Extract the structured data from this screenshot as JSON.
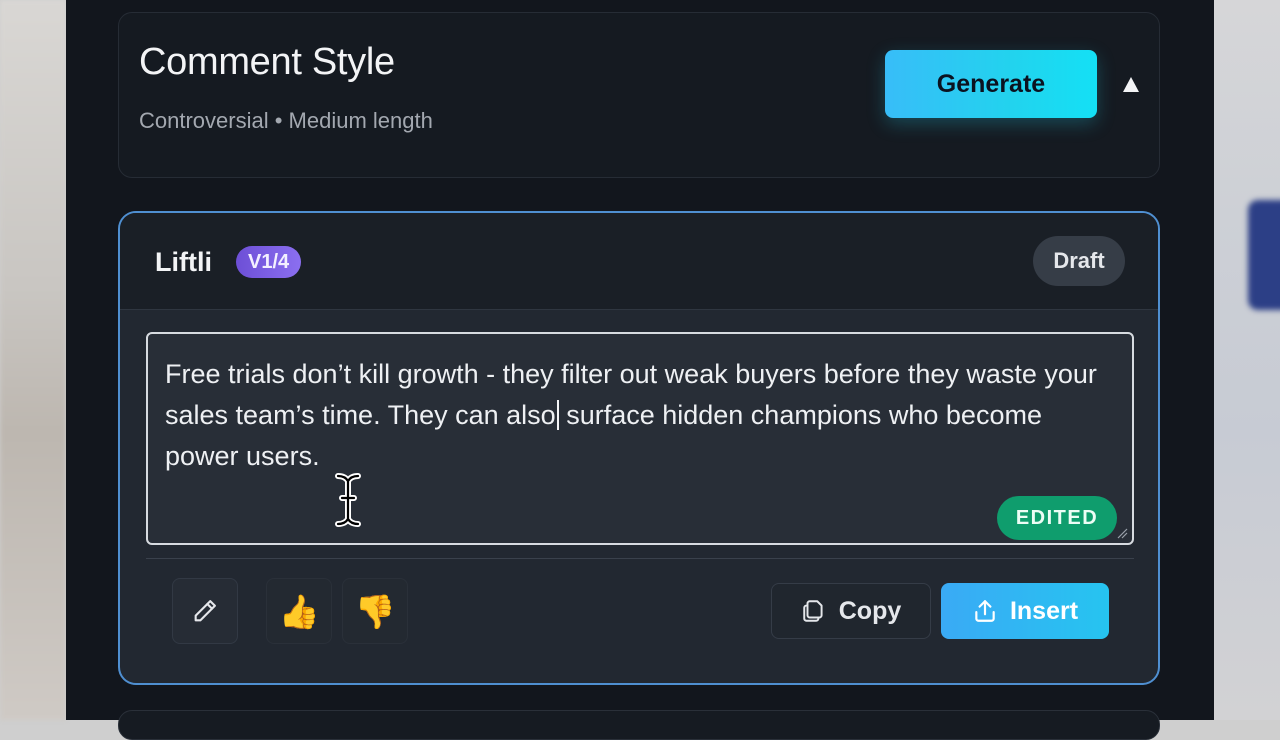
{
  "comment_style": {
    "title": "Comment Style",
    "subtitle": "Controversial • Medium length",
    "generate_label": "Generate"
  },
  "result": {
    "brand": "Liftli",
    "version": "V1/4",
    "status": "Draft",
    "comment_before_caret": "Free trials don’t kill growth - they filter out weak buyers before they waste your sales team’s time. They can also",
    "comment_after_caret": " surface hidden champions who become power users.",
    "edited_label": "EDITED",
    "copy_label": "Copy",
    "insert_label": "Insert"
  },
  "icons": {
    "edit": "pencil-icon",
    "like": "thumbs-up-icon",
    "dislike": "thumbs-down-icon",
    "copy": "copy-icon",
    "insert": "upload-icon",
    "collapse": "triangle-up-icon"
  },
  "colors": {
    "accent": "#22d3ee",
    "card_border": "#4f8fd1",
    "version_badge": "#7c5ce6",
    "edited_badge": "#0f9d6d"
  }
}
